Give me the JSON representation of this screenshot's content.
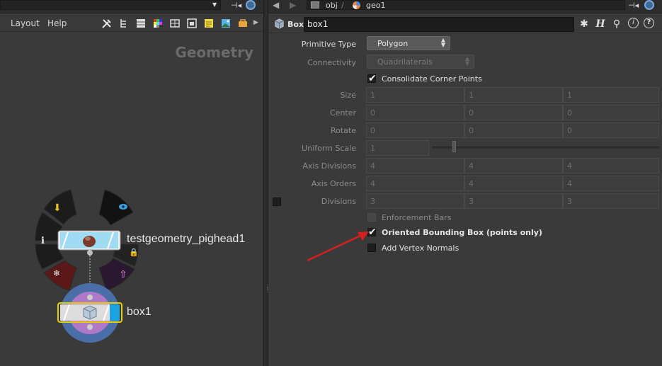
{
  "left_pane": {
    "menu": [
      "Layout",
      "Help"
    ],
    "network_title": "Geometry",
    "nodes": [
      {
        "name": "testgeometry_pighead1"
      },
      {
        "name": "box1"
      }
    ],
    "ring_icons": [
      "download-arrow-icon",
      "eye-icon",
      "info-icon",
      "freeze-icon",
      "lock-icon",
      "output-flag-icon"
    ]
  },
  "right_pane": {
    "breadcrumbs": [
      "obj",
      "geo1"
    ],
    "node_type": "Box",
    "node_name": "box1",
    "header_icons": [
      "gear-icon",
      "houdini-help-icon",
      "search-icon",
      "info-icon",
      "help-icon"
    ],
    "params": {
      "primitive_type": {
        "label": "Primitive Type",
        "value": "Polygon"
      },
      "connectivity": {
        "label": "Connectivity",
        "value": "Quadrilaterals"
      },
      "consolidate": {
        "label": "Consolidate Corner Points",
        "checked": true
      },
      "size": {
        "label": "Size",
        "values": [
          "1",
          "1",
          "1"
        ]
      },
      "center": {
        "label": "Center",
        "values": [
          "0",
          "0",
          "0"
        ]
      },
      "rotate": {
        "label": "Rotate",
        "values": [
          "0",
          "0",
          "0"
        ]
      },
      "uniform_scale": {
        "label": "Uniform Scale",
        "value": "1"
      },
      "axis_divisions": {
        "label": "Axis Divisions",
        "values": [
          "4",
          "4",
          "4"
        ]
      },
      "axis_orders": {
        "label": "Axis Orders",
        "values": [
          "4",
          "4",
          "4"
        ]
      },
      "divisions": {
        "label": "Divisions",
        "values": [
          "3",
          "3",
          "3"
        ]
      },
      "enforcement_bars": {
        "label": "Enforcement Bars",
        "checked": false
      },
      "oriented_bbox": {
        "label": "Oriented Bounding Box (points only)",
        "checked": true
      },
      "add_vertex_normals": {
        "label": "Add Vertex Normals",
        "checked": false
      }
    }
  },
  "colors": {
    "accent_arrow": "#d42020",
    "node_selected_outline": "#e8d000",
    "node_blue_flag": "#19a3e0",
    "link_blue": "#3e6a9a"
  }
}
